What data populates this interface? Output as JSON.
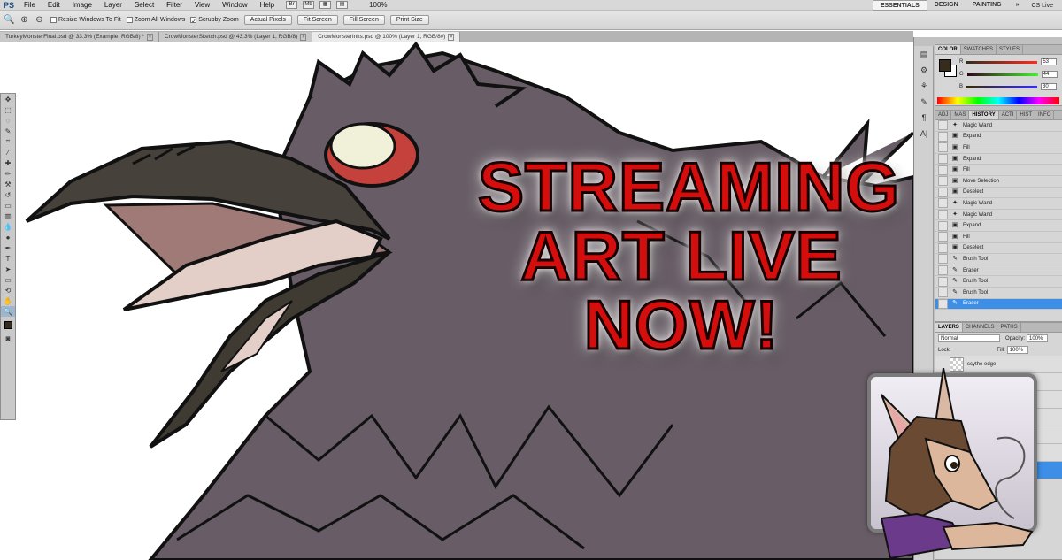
{
  "app": {
    "logo": "PS"
  },
  "menu": {
    "items": [
      "File",
      "Edit",
      "Image",
      "Layer",
      "Select",
      "Filter",
      "View",
      "Window",
      "Help"
    ],
    "zoom": "100%"
  },
  "workspace": {
    "buttons": [
      "ESSENTIALS",
      "DESIGN",
      "PAINTING"
    ],
    "active": "ESSENTIALS",
    "more": "»",
    "cslive": "CS Live"
  },
  "options": {
    "checks": [
      "Resize Windows To Fit",
      "Zoom All Windows",
      "Scrubby Zoom"
    ],
    "buttons": [
      "Actual Pixels",
      "Fit Screen",
      "Fill Screen",
      "Print Size"
    ]
  },
  "tabs": [
    {
      "label": "TurkeyMonsterFinal.psd @ 33.3% (Example, RGB/8) *",
      "close": "×"
    },
    {
      "label": "CrowMonsterSketch.psd @ 43.3% (Layer 1, RGB/8)",
      "close": "×"
    },
    {
      "label": "CrowMonsterInks.psd @ 100% (Layer 1, RGB/8#)",
      "close": "×"
    }
  ],
  "color_panel": {
    "tabs": [
      "COLOR",
      "SWATCHES",
      "STYLES"
    ],
    "active_tab": "COLOR",
    "channels": [
      {
        "label": "R",
        "value": "53",
        "color": "#d22a2a"
      },
      {
        "label": "G",
        "value": "44",
        "color": "#2aa02a"
      },
      {
        "label": "B",
        "value": "30",
        "color": "#2a3ad2"
      }
    ],
    "foreground": "#352c1e"
  },
  "history_panel": {
    "tabs": [
      "ADJ",
      "MAS",
      "HISTORY",
      "ACTI",
      "HIST",
      "INFO"
    ],
    "active_tab": "HISTORY",
    "steps": [
      "Magic Wand",
      "Expand",
      "Fill",
      "Expand",
      "Fill",
      "Move Selection",
      "Deselect",
      "Magic Wand",
      "Magic Wand",
      "Expand",
      "Fill",
      "Deselect",
      "Brush Tool",
      "Eraser",
      "Brush Tool",
      "Brush Tool",
      "Eraser"
    ],
    "selected": "Eraser"
  },
  "layers_panel": {
    "tabs": [
      "LAYERS",
      "CHANNELS",
      "PATHS"
    ],
    "active_tab": "LAYERS",
    "blend_mode": "Normal",
    "opacity_label": "Opacity:",
    "opacity": "100%",
    "lock_label": "Lock:",
    "fill_label": "Fill:",
    "fill": "100%",
    "layers": [
      "scythe edge"
    ]
  },
  "overlay": {
    "line1": "STREAMING",
    "line2": "ART LIVE",
    "line3": "NOW!"
  },
  "colors": {
    "crow": "#685d66",
    "beak": "#46413a",
    "mouth": "#e4cfc8",
    "eye_ring": "#c4413c",
    "eye": "#f1f1da",
    "text_red": "#d40d0d"
  }
}
